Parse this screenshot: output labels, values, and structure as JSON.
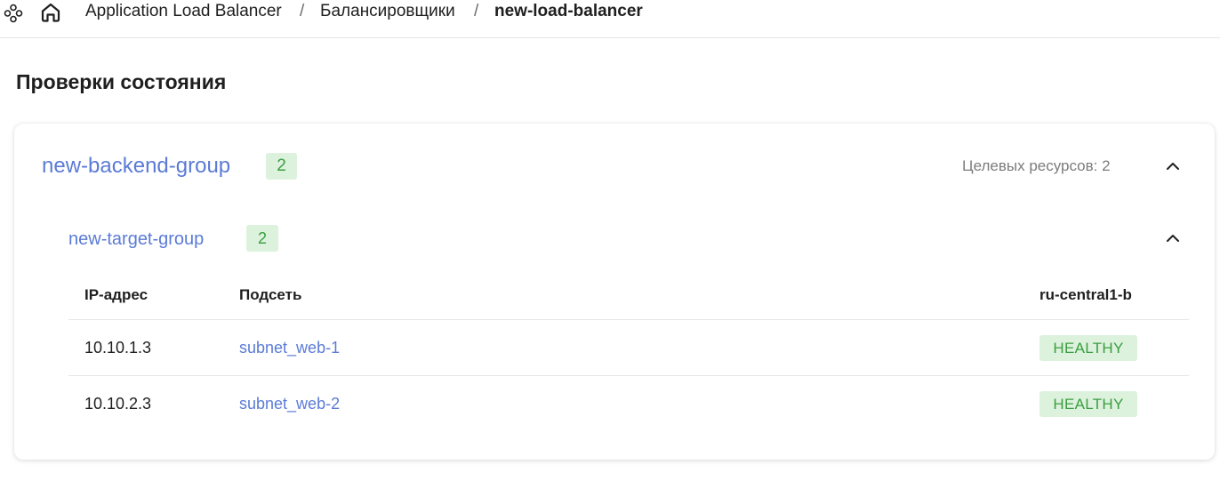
{
  "breadcrumbs": {
    "service": "Application Load Balancer",
    "section": "Балансировщики",
    "current": "new-load-balancer",
    "separator": "/"
  },
  "page": {
    "title": "Проверки состояния"
  },
  "backend_group": {
    "name": "new-backend-group",
    "count": "2",
    "targets_label": "Целевых ресурсов: 2",
    "target_group": {
      "name": "new-target-group",
      "count": "2",
      "columns": {
        "ip": "IP-адрес",
        "subnet": "Подсеть",
        "zone": "ru-central1-b"
      },
      "rows": [
        {
          "ip": "10.10.1.3",
          "subnet": "subnet_web-1",
          "status": "HEALTHY"
        },
        {
          "ip": "10.10.2.3",
          "subnet": "subnet_web-2",
          "status": "HEALTHY"
        }
      ]
    }
  },
  "icons": {
    "services": "services-menu-icon",
    "home": "home-icon",
    "collapse": "chevron-up-icon"
  },
  "colors": {
    "link": "#5b7bd5",
    "badge_bg": "#dcf2dd",
    "badge_text": "#3c9d41"
  }
}
